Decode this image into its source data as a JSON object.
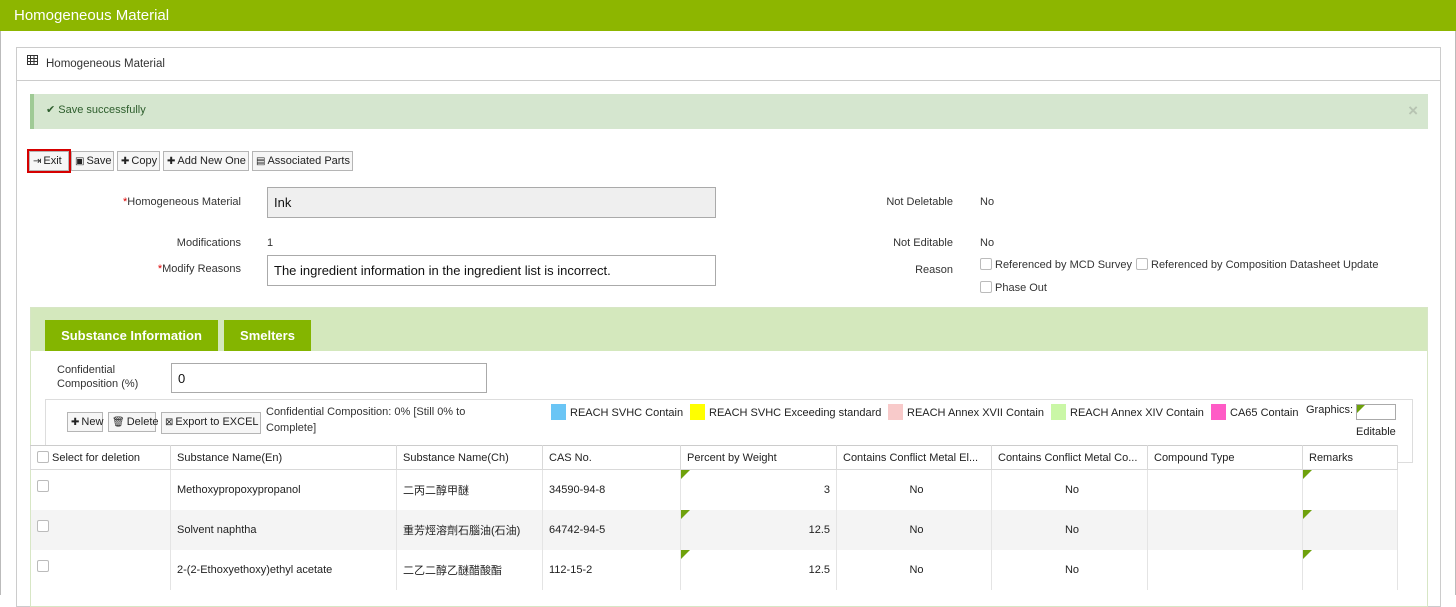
{
  "window": {
    "title": "Homogeneous Material"
  },
  "panel": {
    "title": "Homogeneous Material"
  },
  "alert": {
    "message": "Save successfully",
    "close": "×"
  },
  "toolbar": {
    "exit": "Exit",
    "save": "Save",
    "copy": "Copy",
    "add_new": "Add New One",
    "associated_parts": "Associated Parts"
  },
  "form": {
    "homogeneous_material_label": "Homogeneous Material",
    "homogeneous_material_value": "Ink",
    "modifications_label": "Modifications",
    "modifications_value": "1",
    "modify_reasons_label": "Modify Reasons",
    "modify_reasons_value": "The ingredient information in the ingredient list is incorrect.",
    "not_deletable_label": "Not Deletable",
    "not_deletable_value": "No",
    "not_editable_label": "Not Editable",
    "not_editable_value": "No",
    "reason_label": "Reason",
    "reasons": [
      "Referenced by MCD Survey",
      "Referenced by Composition Datasheet Update",
      "Phase Out"
    ]
  },
  "tabs": [
    "Substance Information",
    "Smelters"
  ],
  "confidential": {
    "label_line1": "Confidential",
    "label_line2": "Composition (%)",
    "value": "0"
  },
  "grid_toolbar": {
    "new": "New",
    "delete": "Delete",
    "export": "Export to EXCEL",
    "status_line1": "Confidential Composition: 0% [Still 0% to",
    "status_line2": "Complete]"
  },
  "legend": [
    {
      "label": "REACH SVHC Contain",
      "color": "#6ac5f5"
    },
    {
      "label": "REACH SVHC Exceeding standard",
      "color": "#ffff00"
    },
    {
      "label": "REACH Annex XVII Contain",
      "color": "#f8caca"
    },
    {
      "label": "REACH Annex XIV Contain",
      "color": "#caf7a6"
    },
    {
      "label": "CA65 Contain",
      "color": "#ff5bc6"
    }
  ],
  "graphics": {
    "label": "Graphics:",
    "editable": "Editable"
  },
  "table": {
    "headers": [
      "Select for deletion",
      "Substance Name(En)",
      "Substance Name(Ch)",
      "CAS No.",
      "Percent by Weight",
      "Contains Conflict Metal El...",
      "Contains Conflict Metal Co...",
      "Compound Type",
      "Remarks"
    ],
    "rows": [
      {
        "en": "Methoxypropoxypropanol",
        "ch": "二丙二醇甲醚",
        "cas": "34590-94-8",
        "pct": "3",
        "el": "No",
        "co": "No",
        "type": "",
        "remarks": ""
      },
      {
        "en": "Solvent naphtha",
        "ch": "重芳烴溶劑石腦油(石油)",
        "cas": "64742-94-5",
        "pct": "12.5",
        "el": "No",
        "co": "No",
        "type": "",
        "remarks": ""
      },
      {
        "en": "2-(2-Ethoxyethoxy)ethyl acetate",
        "ch": "二乙二醇乙醚醋酸酯",
        "cas": "112-15-2",
        "pct": "12.5",
        "el": "No",
        "co": "No",
        "type": "",
        "remarks": ""
      }
    ]
  }
}
